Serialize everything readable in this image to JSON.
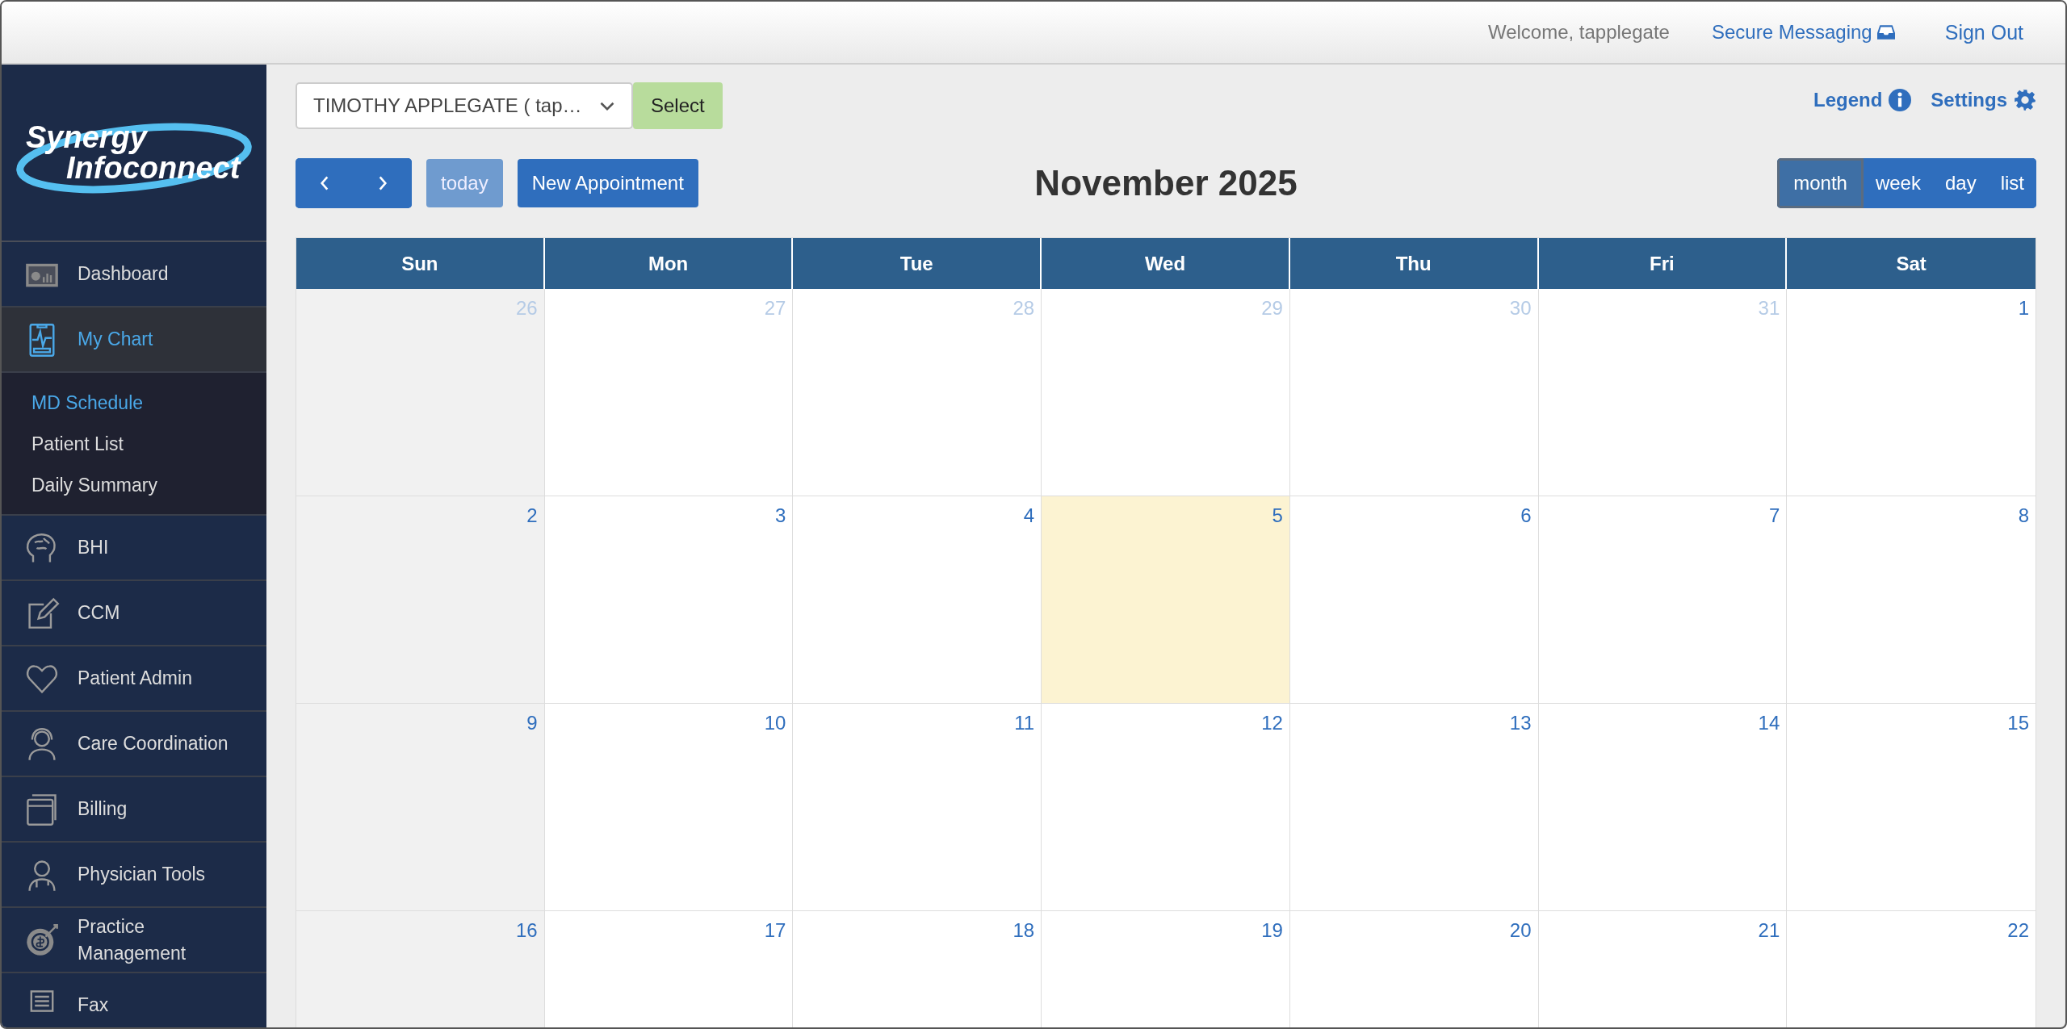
{
  "top_bar": {
    "welcome": "Welcome, tapplegate",
    "links": [
      {
        "label": "Secure Messaging",
        "kind": "messaging"
      },
      {
        "label": "Sign Out",
        "kind": "signout"
      }
    ]
  },
  "sidebar": {
    "logo": {
      "line_1": "Synergy",
      "line_2": "Infoconnect"
    },
    "items": [
      {
        "label": "Dashboard",
        "selected": false,
        "expanded": false
      },
      {
        "label": "My Chart",
        "selected": true,
        "expanded": true,
        "children": [
          {
            "label": "MD Schedule",
            "selected": true
          },
          {
            "label": "Patient List",
            "selected": false
          },
          {
            "label": "Daily Summary",
            "selected": false
          }
        ]
      },
      {
        "label": "BHI",
        "selected": false,
        "expanded": false
      },
      {
        "label": "CCM",
        "selected": false,
        "expanded": false
      },
      {
        "label": "Patient Admin",
        "selected": false,
        "expanded": false
      },
      {
        "label": "Care Coordination",
        "selected": false,
        "expanded": false
      },
      {
        "label": "Billing",
        "selected": false,
        "expanded": false
      },
      {
        "label": "Physician Tools",
        "selected": false,
        "expanded": false
      },
      {
        "label": "Practice Management",
        "selected": false,
        "expanded": false
      },
      {
        "label": "Fax",
        "selected": false,
        "expanded": false
      }
    ]
  },
  "toolbar": {
    "patient_select": {
      "value": "TIMOTHY APPLEGATE ( tap…"
    },
    "select_button": "Select",
    "legend": "Legend",
    "settings": "Settings",
    "today_button": {
      "label": "today",
      "disabled": true
    },
    "new_appointment": "New Appointment",
    "title": "November 2025",
    "views": [
      {
        "label": "month",
        "selected": true
      },
      {
        "label": "week",
        "selected": false
      },
      {
        "label": "day",
        "selected": false
      },
      {
        "label": "list",
        "selected": false
      }
    ]
  },
  "calendar": {
    "columns": [
      {
        "label": "Sun"
      },
      {
        "label": "Mon"
      },
      {
        "label": "Tue"
      },
      {
        "label": "Wed"
      },
      {
        "label": "Thu"
      },
      {
        "label": "Fri"
      },
      {
        "label": "Sat"
      }
    ],
    "weeks": [
      [
        {
          "day": "26",
          "other_month": true,
          "today": false
        },
        {
          "day": "27",
          "other_month": true,
          "today": false
        },
        {
          "day": "28",
          "other_month": true,
          "today": false
        },
        {
          "day": "29",
          "other_month": true,
          "today": false
        },
        {
          "day": "30",
          "other_month": true,
          "today": false
        },
        {
          "day": "31",
          "other_month": true,
          "today": false
        },
        {
          "day": "1",
          "other_month": false,
          "today": false
        }
      ],
      [
        {
          "day": "2",
          "other_month": false,
          "today": false
        },
        {
          "day": "3",
          "other_month": false,
          "today": false
        },
        {
          "day": "4",
          "other_month": false,
          "today": false
        },
        {
          "day": "5",
          "other_month": false,
          "today": true
        },
        {
          "day": "6",
          "other_month": false,
          "today": false
        },
        {
          "day": "7",
          "other_month": false,
          "today": false
        },
        {
          "day": "8",
          "other_month": false,
          "today": false
        }
      ],
      [
        {
          "day": "9",
          "other_month": false,
          "today": false
        },
        {
          "day": "10",
          "other_month": false,
          "today": false
        },
        {
          "day": "11",
          "other_month": false,
          "today": false
        },
        {
          "day": "12",
          "other_month": false,
          "today": false
        },
        {
          "day": "13",
          "other_month": false,
          "today": false
        },
        {
          "day": "14",
          "other_month": false,
          "today": false
        },
        {
          "day": "15",
          "other_month": false,
          "today": false
        }
      ],
      [
        {
          "day": "16",
          "other_month": false,
          "today": false
        },
        {
          "day": "17",
          "other_month": false,
          "today": false
        },
        {
          "day": "18",
          "other_month": false,
          "today": false
        },
        {
          "day": "19",
          "other_month": false,
          "today": false
        },
        {
          "day": "20",
          "other_month": false,
          "today": false
        },
        {
          "day": "21",
          "other_month": false,
          "today": false
        },
        {
          "day": "22",
          "other_month": false,
          "today": false
        }
      ]
    ]
  }
}
